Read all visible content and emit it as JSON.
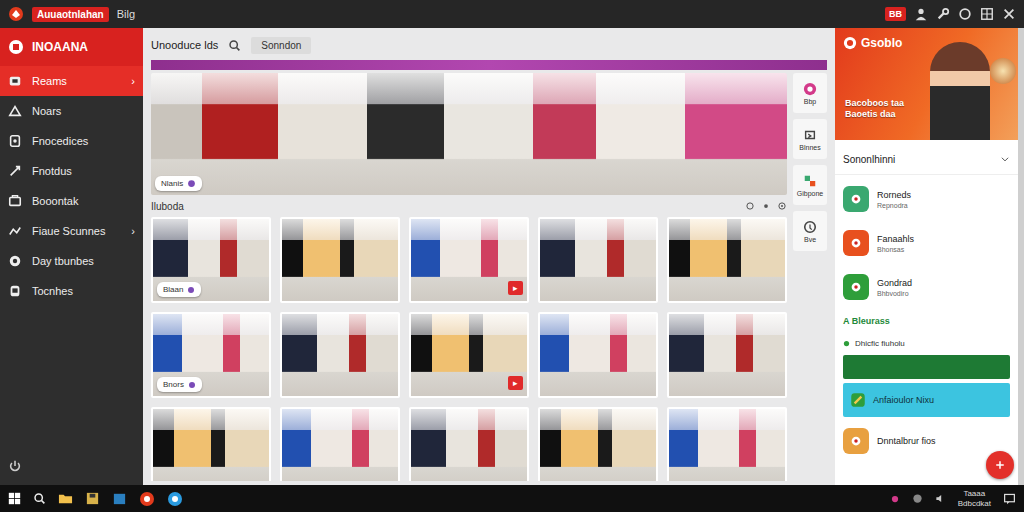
{
  "topbar": {
    "app_name": "Auuaotnlahan",
    "menu": "Bilg",
    "badge": "BB"
  },
  "sidebar": {
    "brand": "INOAANA",
    "items": [
      {
        "label": "Reams",
        "selected": true,
        "chevron": "›"
      },
      {
        "label": "Noars",
        "selected": false
      },
      {
        "label": "Fnocedices",
        "selected": false
      },
      {
        "label": "Fnotdus",
        "selected": false
      },
      {
        "label": "Booontak",
        "selected": false
      },
      {
        "label": "Fiaue Scunnes",
        "selected": false,
        "chevron": "›"
      },
      {
        "label": "Day tbunbes",
        "selected": false
      },
      {
        "label": "Tocnhes",
        "selected": false
      }
    ]
  },
  "main": {
    "title": "Unooduce lds",
    "tab": "Sonndon",
    "hero_chip": "Nlanis",
    "section": "Iluboda",
    "tools": [
      "Bbp",
      "Blnnes",
      "Gibpone",
      "Bve"
    ],
    "thumbnails": [
      {
        "kind": "chip",
        "label": "Blaan"
      },
      {
        "kind": "plain"
      },
      {
        "kind": "red",
        "label": "▸"
      },
      {
        "kind": "plain"
      },
      {
        "kind": "plain"
      },
      {
        "kind": "chip",
        "label": "Bnors"
      },
      {
        "kind": "plain"
      },
      {
        "kind": "red",
        "label": "▸"
      },
      {
        "kind": "plain"
      },
      {
        "kind": "plain"
      },
      {
        "kind": "plain"
      },
      {
        "kind": "plain"
      },
      {
        "kind": "plain"
      },
      {
        "kind": "plain"
      },
      {
        "kind": "plain"
      }
    ]
  },
  "ad": {
    "title": "Gsoblo",
    "lines": [
      "Bacoboos taa",
      "Baoetis daa"
    ]
  },
  "panel": {
    "header": "Sononlhinni",
    "items": [
      {
        "kind": "app",
        "title": "Rorneds",
        "subtitle": "Repnodra",
        "color": "#3aa870"
      },
      {
        "kind": "app",
        "title": "Fanaahls",
        "subtitle": "Bhonsas",
        "color": "#e8501e"
      },
      {
        "kind": "app",
        "title": "Gondrad",
        "subtitle": "Bhbvodiro",
        "color": "#2e9e3a"
      },
      {
        "kind": "heading",
        "title": "A Bleurass"
      },
      {
        "kind": "note",
        "title": "Dhicfic fiuholu"
      },
      {
        "kind": "bar",
        "color": "#1e7a34"
      },
      {
        "kind": "bar",
        "title": "Anfaioulor Nixu",
        "color": "#3cc4e0"
      },
      {
        "kind": "app",
        "title": "Dnntalbrur fios",
        "color": "#e8a040"
      }
    ]
  },
  "taskbar": {
    "time": "Taaaa",
    "date": "Bdbcdkat"
  }
}
